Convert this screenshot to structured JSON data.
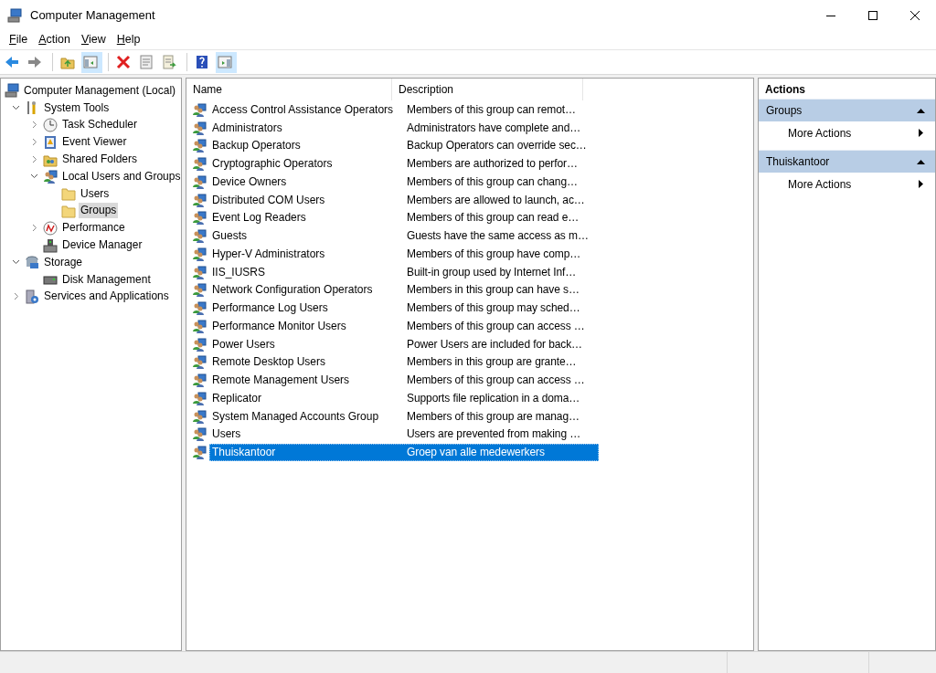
{
  "window": {
    "title": "Computer Management"
  },
  "menu": [
    "File",
    "Action",
    "View",
    "Help"
  ],
  "toolbar": [
    {
      "pressed": false
    },
    {
      "pressed": false
    },
    {
      "pressed": false
    },
    {
      "pressed": true
    },
    {
      "pressed": false
    },
    {
      "pressed": false
    },
    {
      "pressed": false
    },
    {
      "pressed": false
    },
    {
      "pressed": true
    }
  ],
  "tree": [
    {
      "label": "Computer Management (Local)",
      "selected": false,
      "children": [
        {
          "label": "System Tools",
          "selected": false,
          "expanded": true,
          "children": [
            {
              "label": "Task Scheduler",
              "selected": false,
              "expanded": false
            },
            {
              "label": "Event Viewer",
              "selected": false,
              "expanded": false
            },
            {
              "label": "Shared Folders",
              "selected": false,
              "expanded": false
            },
            {
              "label": "Local Users and Groups",
              "selected": false,
              "expanded": true,
              "children": [
                {
                  "label": "Users",
                  "selected": false
                },
                {
                  "label": "Groups",
                  "selected": true
                }
              ]
            },
            {
              "label": "Performance",
              "selected": false,
              "expanded": false
            },
            {
              "label": "Device Manager",
              "selected": false
            }
          ]
        },
        {
          "label": "Storage",
          "selected": false,
          "expanded": true,
          "children": [
            {
              "label": "Disk Management",
              "selected": false
            }
          ]
        },
        {
          "label": "Services and Applications",
          "selected": false,
          "expanded": false
        }
      ]
    }
  ],
  "table": {
    "columns": [
      "Name",
      "Description"
    ],
    "rows": [
      {
        "name": "Access Control Assistance Operators",
        "description": "Members of this group can remot…",
        "selected": false
      },
      {
        "name": "Administrators",
        "description": "Administrators have complete and…",
        "selected": false
      },
      {
        "name": "Backup Operators",
        "description": "Backup Operators can override sec…",
        "selected": false
      },
      {
        "name": "Cryptographic Operators",
        "description": "Members are authorized to perfor…",
        "selected": false
      },
      {
        "name": "Device Owners",
        "description": "Members of this group can chang…",
        "selected": false
      },
      {
        "name": "Distributed COM Users",
        "description": "Members are allowed to launch, ac…",
        "selected": false
      },
      {
        "name": "Event Log Readers",
        "description": "Members of this group can read e…",
        "selected": false
      },
      {
        "name": "Guests",
        "description": "Guests have the same access as m…",
        "selected": false
      },
      {
        "name": "Hyper-V Administrators",
        "description": "Members of this group have comp…",
        "selected": false
      },
      {
        "name": "IIS_IUSRS",
        "description": "Built-in group used by Internet Inf…",
        "selected": false
      },
      {
        "name": "Network Configuration Operators",
        "description": "Members in this group can have s…",
        "selected": false
      },
      {
        "name": "Performance Log Users",
        "description": "Members of this group may sched…",
        "selected": false
      },
      {
        "name": "Performance Monitor Users",
        "description": "Members of this group can access …",
        "selected": false
      },
      {
        "name": "Power Users",
        "description": "Power Users are included for back…",
        "selected": false
      },
      {
        "name": "Remote Desktop Users",
        "description": "Members in this group are grante…",
        "selected": false
      },
      {
        "name": "Remote Management Users",
        "description": "Members of this group can access …",
        "selected": false
      },
      {
        "name": "Replicator",
        "description": "Supports file replication in a doma…",
        "selected": false
      },
      {
        "name": "System Managed Accounts Group",
        "description": "Members of this group are manag…",
        "selected": false
      },
      {
        "name": "Users",
        "description": "Users are prevented from making …",
        "selected": false
      },
      {
        "name": "Thuiskantoor",
        "description": "Groep van alle medewerkers",
        "selected": true
      }
    ]
  },
  "actions": {
    "title": "Actions",
    "sections": [
      {
        "title": "Groups",
        "expanded": true,
        "items": [
          "More Actions"
        ]
      },
      {
        "title": "Thuiskantoor",
        "expanded": true,
        "items": [
          "More Actions"
        ]
      }
    ]
  }
}
